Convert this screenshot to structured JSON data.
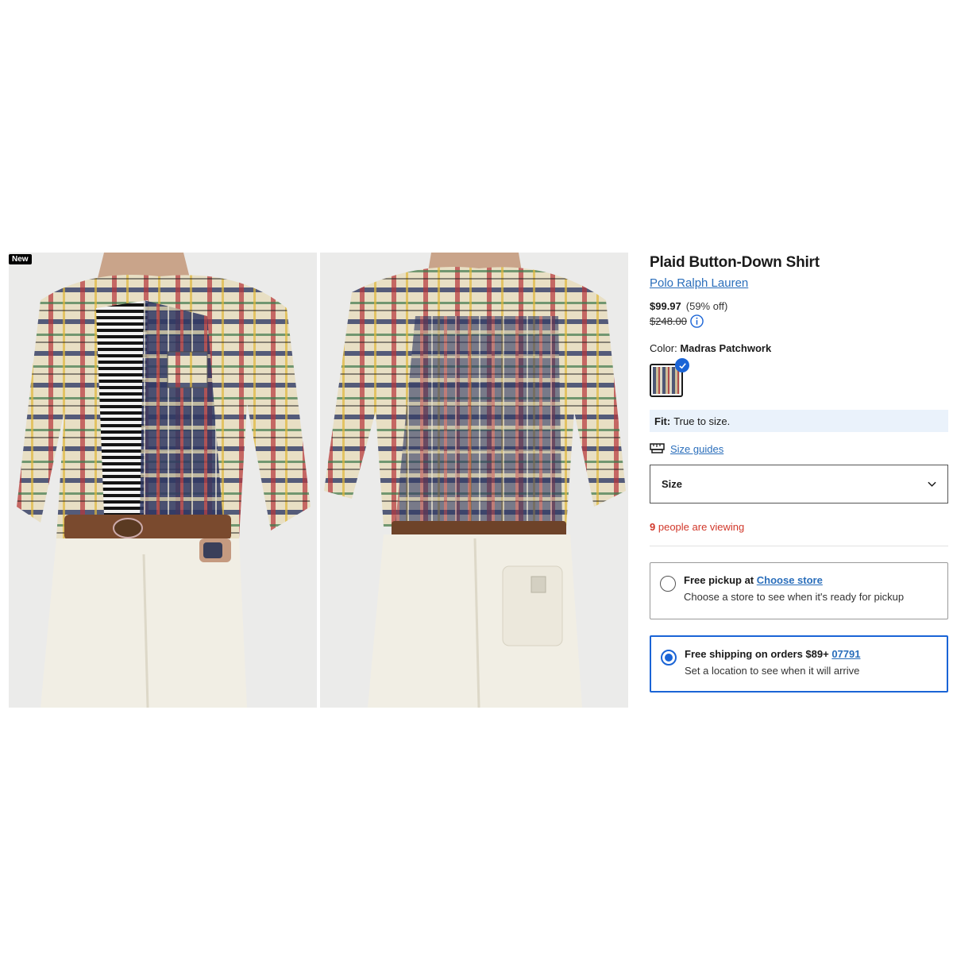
{
  "gallery": {
    "badge": "New",
    "images": [
      {
        "alt": "model-front-view"
      },
      {
        "alt": "model-back-view"
      }
    ]
  },
  "product": {
    "title": "Plaid Button-Down Shirt",
    "brand": "Polo Ralph Lauren",
    "sale_price": "$99.97",
    "discount": "(59% off)",
    "original_price": "$248.00",
    "color_label": "Color:",
    "color_value": "Madras Patchwork",
    "fit_label": "Fit:",
    "fit_value": "True to size.",
    "size_guides": "Size guides",
    "size_select_label": "Size",
    "viewing_count": "9",
    "viewing_text": "people are viewing"
  },
  "fulfillment": {
    "pickup": {
      "title": "Free pickup at",
      "link": "Choose store",
      "sub": "Choose a store to see when it's ready for pickup"
    },
    "shipping": {
      "title": "Free shipping on orders $89+",
      "link": "07791",
      "sub": "Set a location to see when it will arrive"
    }
  },
  "colors": {
    "link": "#2a6ebb",
    "accent": "#1a64d6",
    "alert": "#d1382b",
    "fit_bg": "#eaf2fb"
  }
}
